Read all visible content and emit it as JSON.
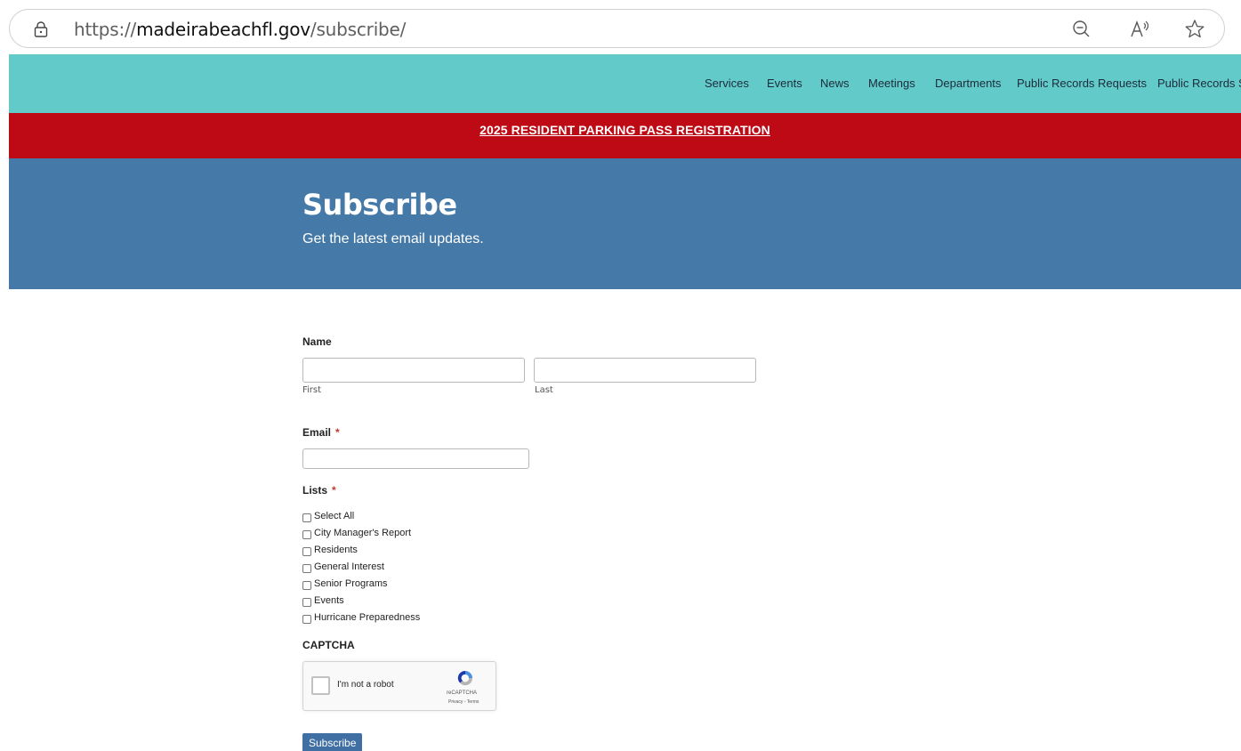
{
  "browser": {
    "url_scheme": "https://",
    "url_host": "madeirabeachfl.gov",
    "url_path": "/subscribe/"
  },
  "nav": {
    "links": [
      "Services",
      "Events",
      "News",
      "Meetings",
      "Departments",
      "Public Records Requests",
      "Public Records Se"
    ]
  },
  "alert": {
    "text": "2025 RESIDENT PARKING PASS REGISTRATION"
  },
  "hero": {
    "title": "Subscribe",
    "subtitle": "Get the latest email updates."
  },
  "form": {
    "name_label": "Name",
    "first_sub": "First",
    "last_sub": "Last",
    "first_value": "",
    "last_value": "",
    "email_label": "Email",
    "email_value": "",
    "required_mark": "*",
    "lists_label": "Lists",
    "lists": [
      "Select All",
      "City Manager's Report",
      "Residents",
      "General Interest",
      "Senior Programs",
      "Events",
      "Hurricane Preparedness"
    ],
    "captcha_label": "CAPTCHA",
    "captcha_text": "I'm not a robot",
    "captcha_brand": "reCAPTCHA",
    "captcha_terms": "Privacy - Terms",
    "submit_label": "Subscribe"
  },
  "colors": {
    "nav_bg": "#62cbc9",
    "alert_bg": "#bd0a14",
    "hero_bg": "#4479a8",
    "button_bg": "#3f6fa3"
  },
  "icons": [
    "lock-icon",
    "zoom-out-icon",
    "read-aloud-icon",
    "favorite-star-icon",
    "recaptcha-logo-icon"
  ]
}
